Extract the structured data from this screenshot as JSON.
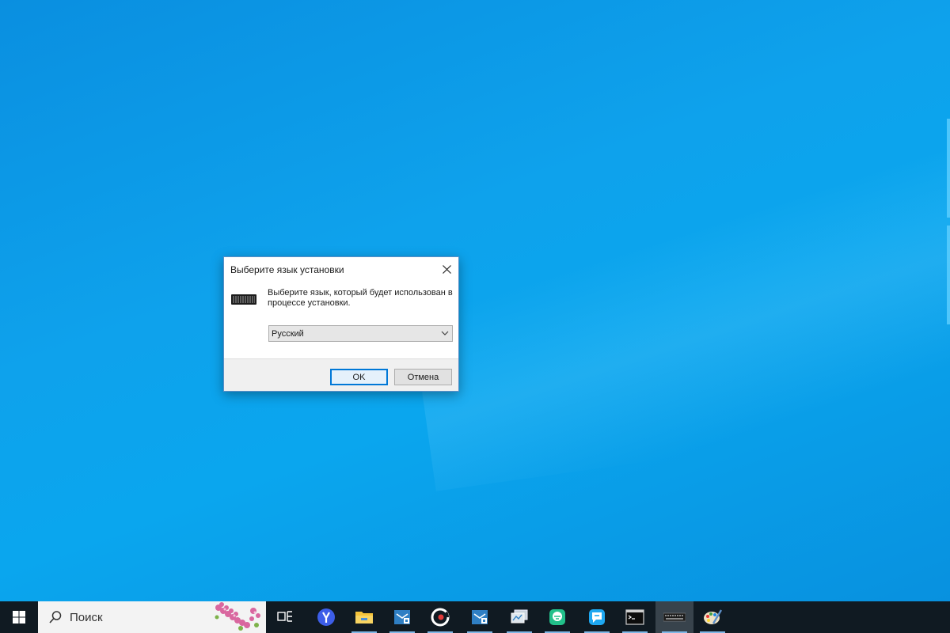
{
  "dialog": {
    "title": "Выберите язык установки",
    "message": "Выберите язык, который будет использован в процессе установки.",
    "language_selected": "Русский",
    "ok_label": "OK",
    "cancel_label": "Отмена"
  },
  "taskbar": {
    "search_placeholder": "Поиск",
    "items": [
      {
        "name": "task-view-icon"
      },
      {
        "name": "yandex-browser-icon"
      },
      {
        "name": "file-explorer-icon"
      },
      {
        "name": "mail-icon"
      },
      {
        "name": "ccleaner-icon"
      },
      {
        "name": "mail-2-icon"
      },
      {
        "name": "network-monitor-icon"
      },
      {
        "name": "chat-app-icon"
      },
      {
        "name": "messenger-icon"
      },
      {
        "name": "command-prompt-icon"
      },
      {
        "name": "keyboard-setup-icon"
      },
      {
        "name": "paint-icon"
      }
    ]
  },
  "colors": {
    "desktop_bg": "#0ea2ec",
    "taskbar_bg": "#101a22",
    "accent": "#0078d7"
  }
}
